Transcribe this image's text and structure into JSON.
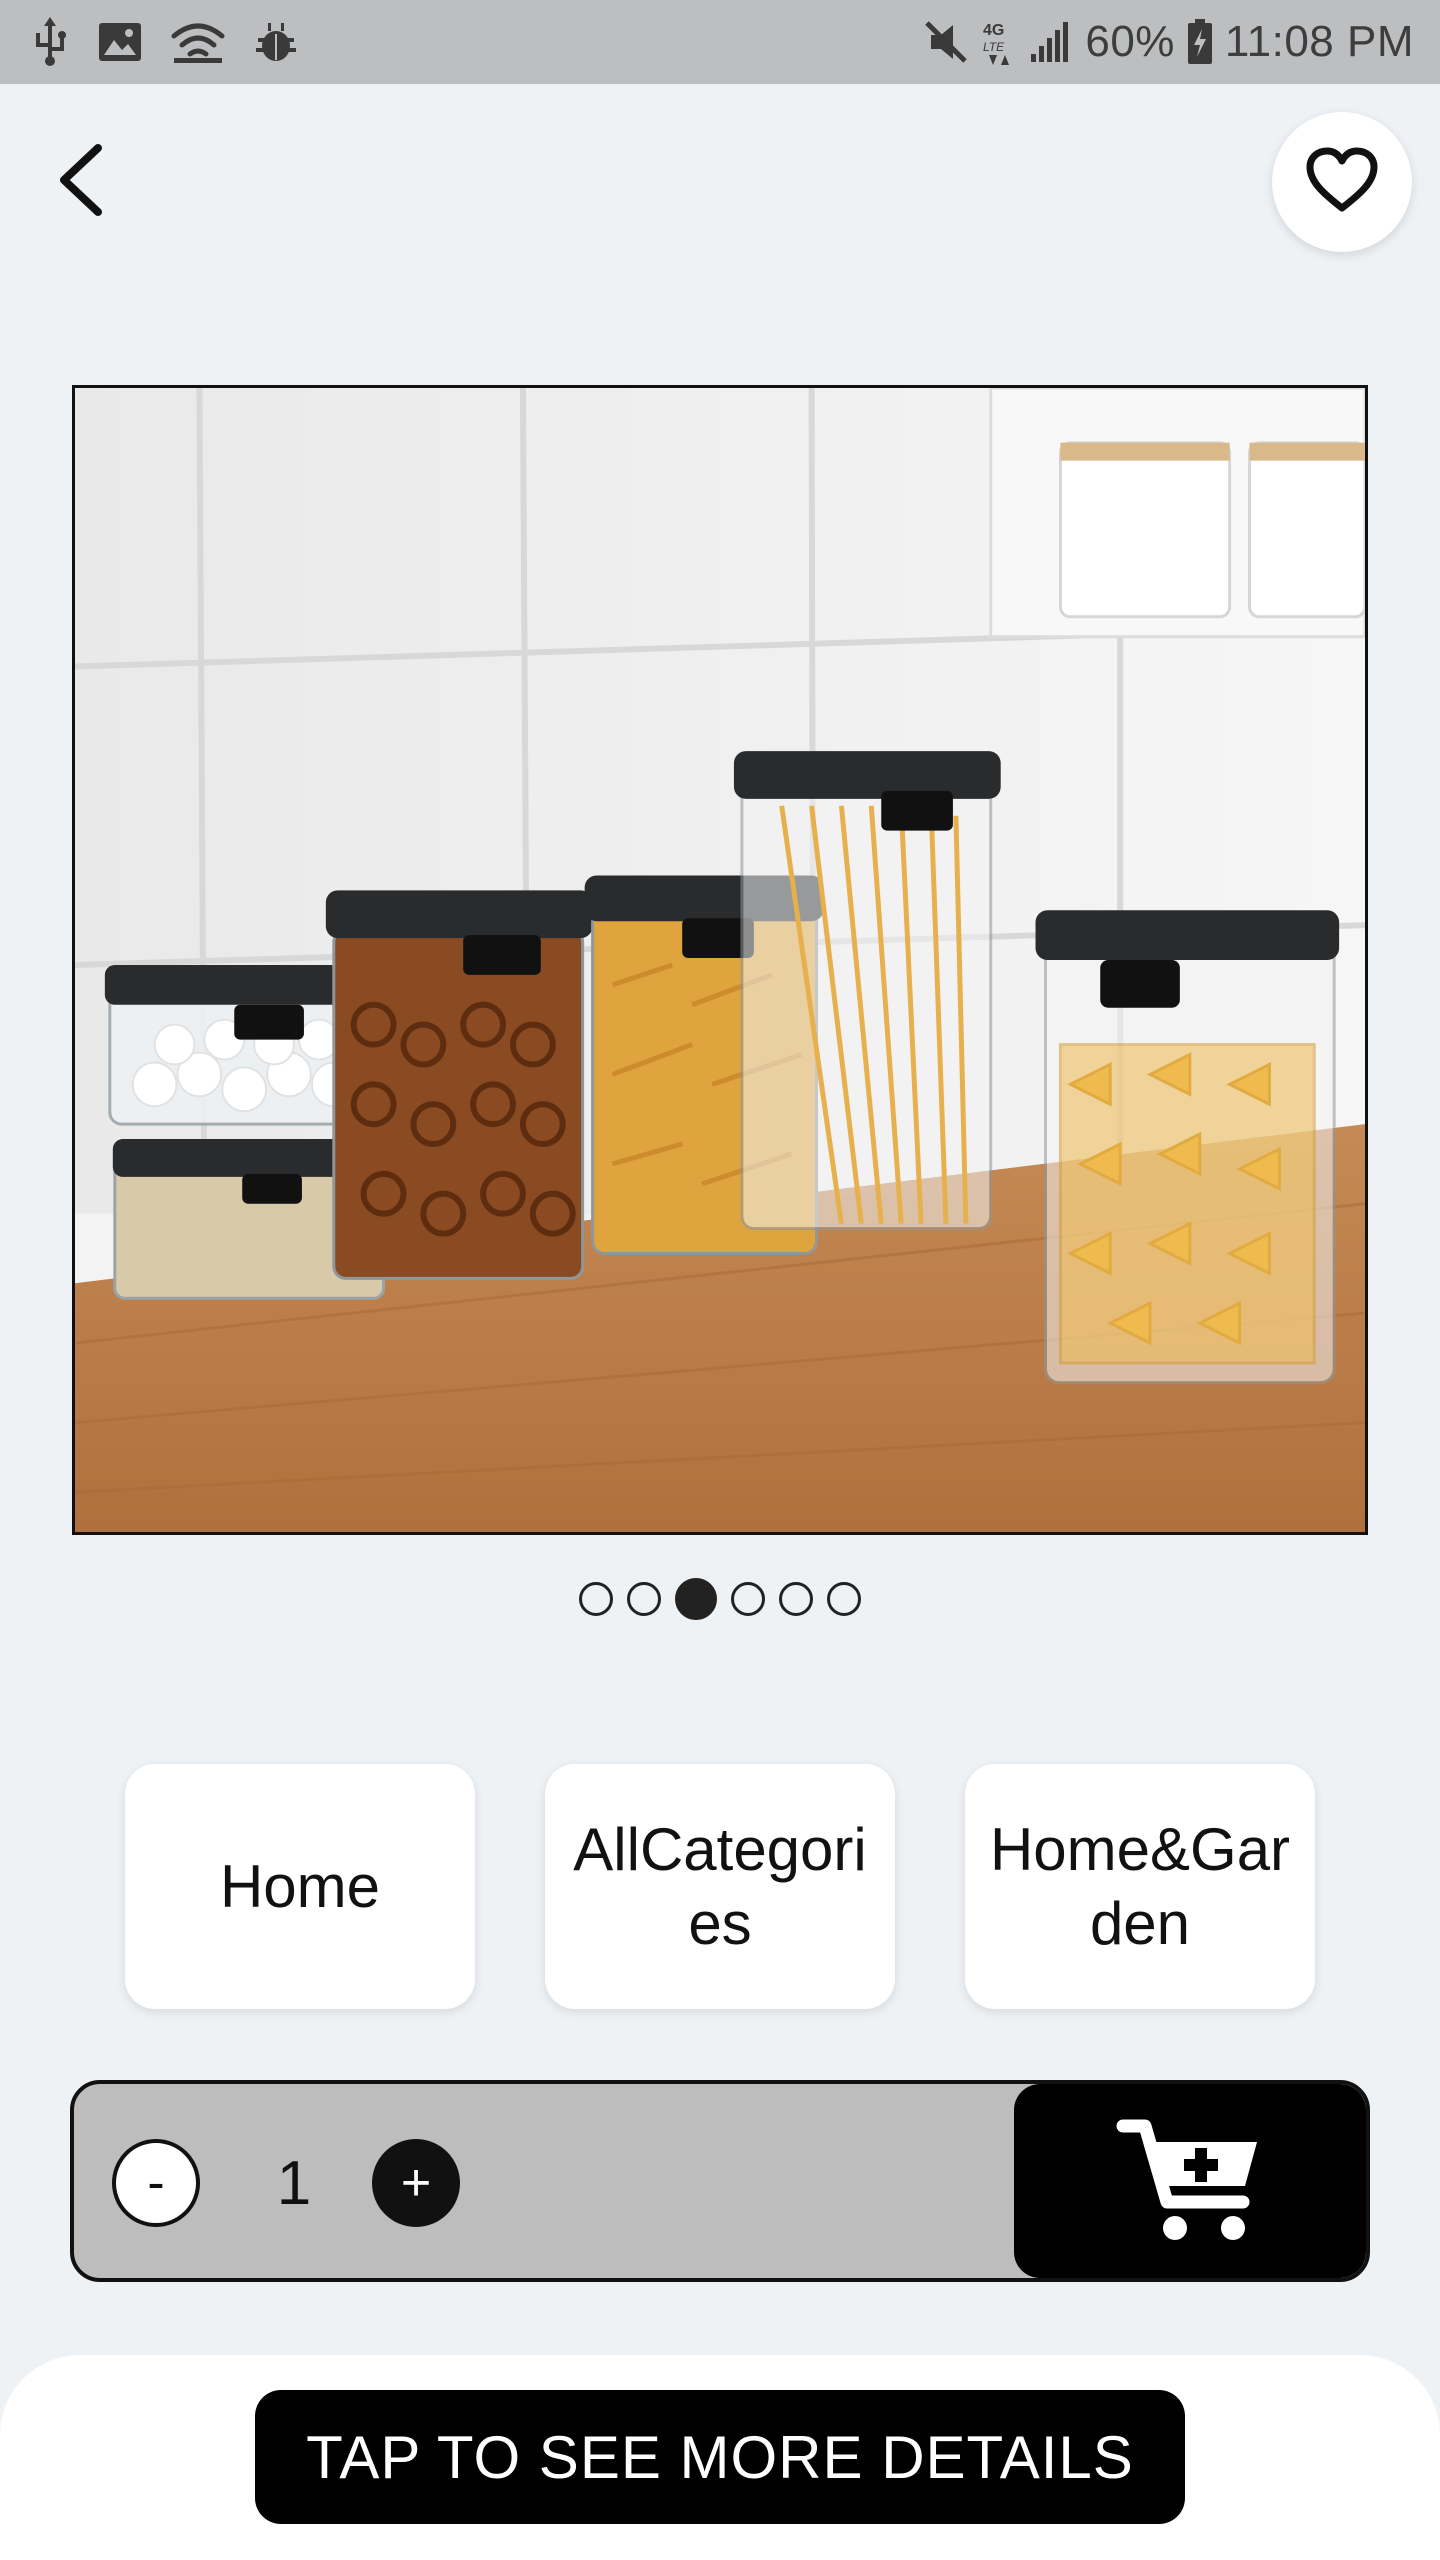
{
  "status_bar": {
    "icons_left": [
      "usb-icon",
      "image-icon",
      "wifi-icon",
      "android-debug-icon"
    ],
    "icons_right": [
      "mute-icon",
      "4g-lte-icon",
      "signal-icon",
      "battery-charging-icon"
    ],
    "battery": "60%",
    "time": "11:08 PM"
  },
  "header": {
    "back_icon": "chevron-left-icon",
    "favorite_icon": "heart-outline-icon"
  },
  "gallery": {
    "image_description": "Clear storage containers with black lids holding marshmallows, oats, pretzels, fusilli, spaghetti and farfalle on a wooden countertop",
    "total_images": 6,
    "active_index": 2
  },
  "categories": [
    {
      "label": "Home"
    },
    {
      "label": "AllCategories"
    },
    {
      "label": "Home&Garden"
    }
  ],
  "cart": {
    "minus_label": "-",
    "quantity": "1",
    "plus_label": "+",
    "add_icon": "cart-plus-icon"
  },
  "details": {
    "label": "TAP TO SEE MORE DETAILS"
  },
  "colors": {
    "background": "#eef2f5",
    "status_bar": "#bdbec0",
    "cart_bar": "#bdbdbd",
    "accent": "#000000"
  }
}
